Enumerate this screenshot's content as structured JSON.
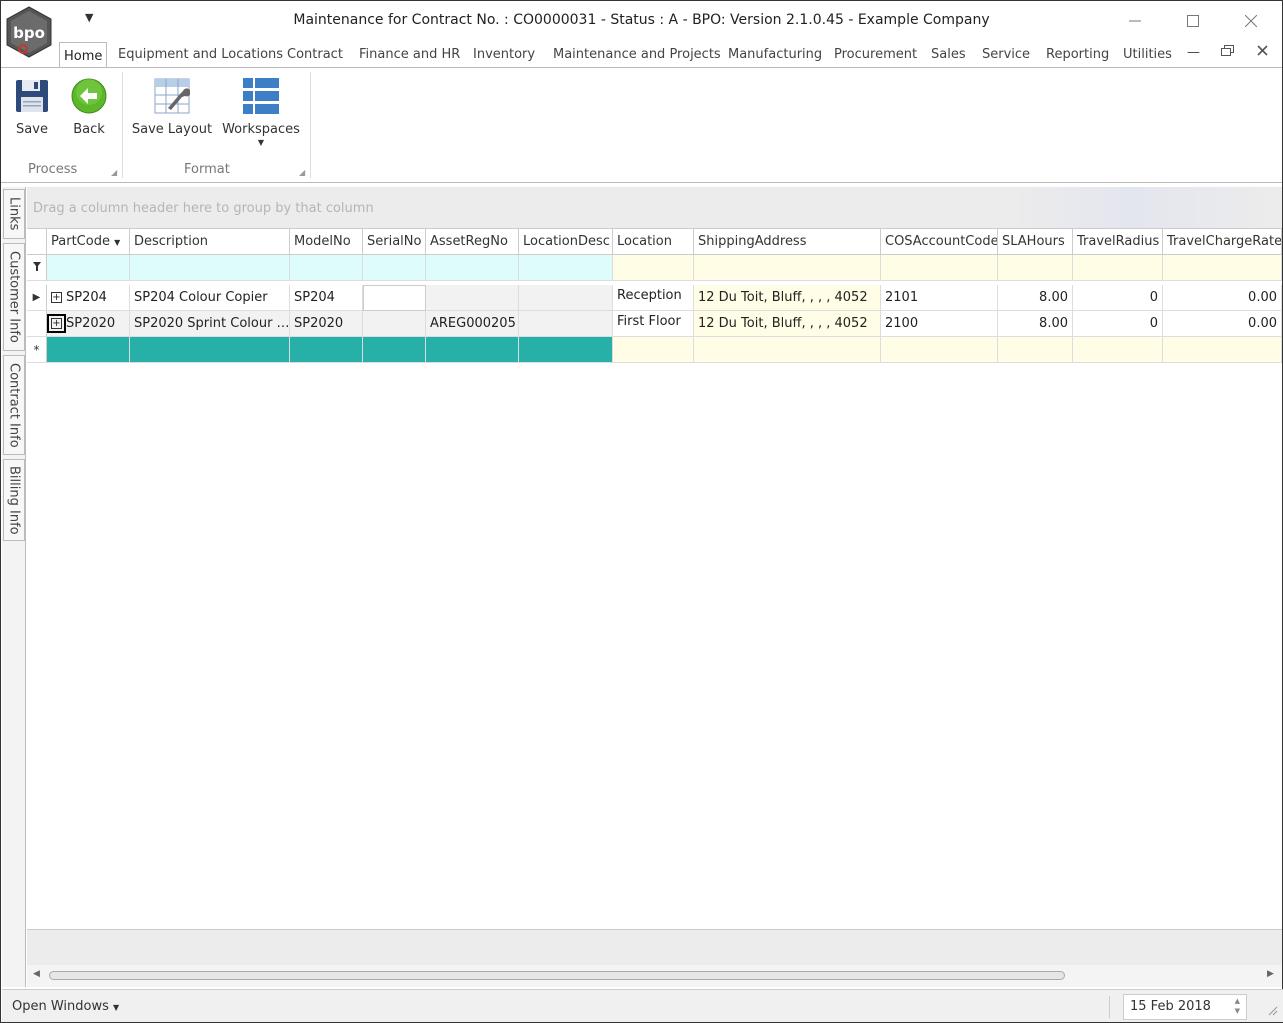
{
  "window": {
    "title": "Maintenance for Contract No. : CO0000031 - Status : A - BPO: Version 2.1.0.45 - Example Company",
    "logo_text": "bpo"
  },
  "ribbon_tabs": [
    "Home",
    "Equipment and Locations",
    "Contract",
    "Finance and HR",
    "Inventory",
    "Maintenance and Projects",
    "Manufacturing",
    "Procurement",
    "Sales",
    "Service",
    "Reporting",
    "Utilities"
  ],
  "ribbon": {
    "save_label": "Save",
    "back_label": "Back",
    "save_layout_label": "Save Layout",
    "workspaces_label": "Workspaces",
    "group_process": "Process",
    "group_format": "Format"
  },
  "side_tabs": [
    "Links",
    "Customer Info",
    "Contract Info",
    "Billing Info"
  ],
  "grid": {
    "group_panel_text": "Drag a column header here to group by that column",
    "columns": [
      "PartCode",
      "Description",
      "ModelNo",
      "SerialNo",
      "AssetRegNo",
      "LocationDesc",
      "Location",
      "ShippingAddress",
      "COSAccountCode",
      "SLAHours",
      "TravelRadius",
      "TravelChargeRate"
    ],
    "rows": [
      {
        "PartCode": "SP204",
        "Description": "SP204 Colour Copier",
        "ModelNo": "SP204",
        "SerialNo": "",
        "AssetRegNo": "",
        "LocationDesc": "",
        "Location": "Reception",
        "ShippingAddress": "12 Du Toit, Bluff, , , , 4052",
        "COSAccountCode": "2101",
        "SLAHours": "8.00",
        "TravelRadius": "0",
        "TravelChargeRate": "0.00"
      },
      {
        "PartCode": "SP2020",
        "Description": "SP2020 Sprint Colour …",
        "ModelNo": "SP2020",
        "SerialNo": "",
        "AssetRegNo": "AREG000205",
        "LocationDesc": "",
        "Location": "First Floor",
        "ShippingAddress": "12 Du Toit, Bluff, , , , 4052",
        "COSAccountCode": "2100",
        "SLAHours": "8.00",
        "TravelRadius": "0",
        "TravelChargeRate": "0.00"
      }
    ]
  },
  "statusbar": {
    "open_windows": "Open Windows",
    "date": "15 Feb 2018"
  },
  "colors": {
    "teal_new_row": "#26b0a8",
    "filter_blue": "#dffcfc",
    "editable_yellow": "#fffde6",
    "save_icon": "#2e4a7a",
    "back_icon": "#5cb82a",
    "workspace_icon": "#3d7fc6"
  }
}
